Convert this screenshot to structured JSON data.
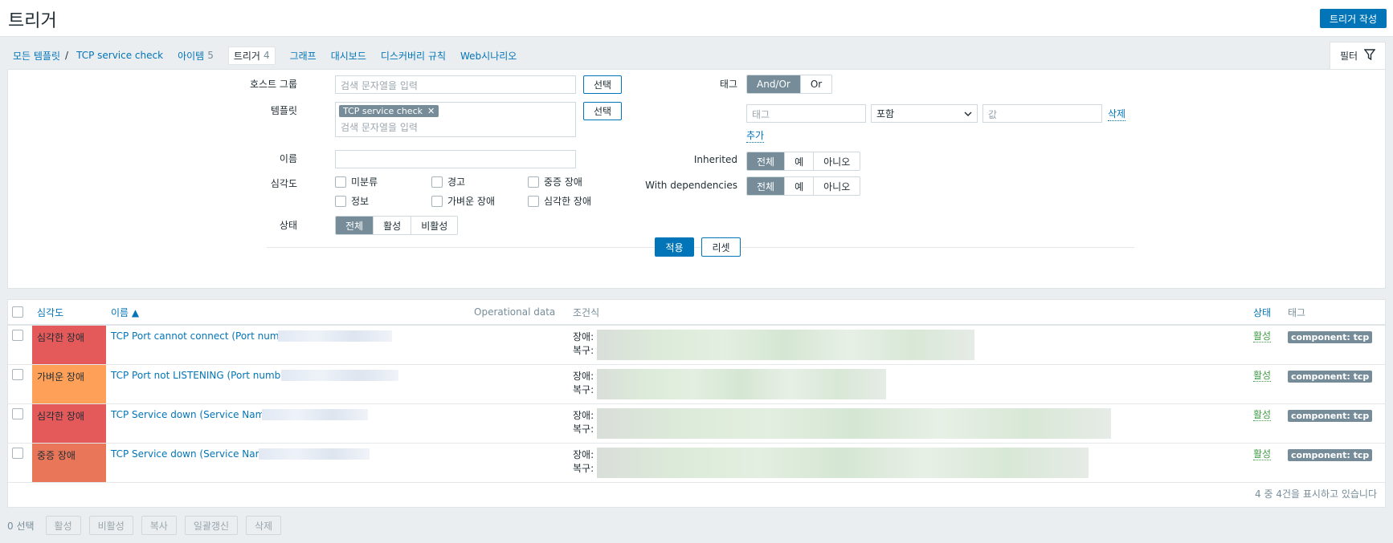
{
  "header": {
    "title": "트리거",
    "create_label": "트리거 작성"
  },
  "nav": {
    "crumbs": [
      "모든 템플릿",
      "TCP service check"
    ],
    "sep": "/",
    "tabs": [
      {
        "label": "아이템",
        "count": "5"
      },
      {
        "label": "트리거",
        "count": "4"
      },
      {
        "label": "그래프",
        "count": ""
      },
      {
        "label": "대시보드",
        "count": ""
      },
      {
        "label": "디스커버리 규칙",
        "count": ""
      },
      {
        "label": "Web시나리오",
        "count": ""
      }
    ]
  },
  "filter": {
    "tab_label": "필터",
    "host_group_label": "호스트 그룹",
    "host_group_placeholder": "검색 문자열을 입력",
    "select_label": "선택",
    "template_label": "템플릿",
    "template_chip": "TCP service check",
    "template_placeholder": "검색 문자열을 입력",
    "name_label": "이름",
    "severity_label": "심각도",
    "severities": [
      "미분류",
      "경고",
      "중증 장애",
      "정보",
      "가벼운 장애",
      "심각한 장애"
    ],
    "state_label": "상태",
    "state_options": [
      "전체",
      "활성",
      "비활성"
    ],
    "tag_label": "태그",
    "tag_logic": [
      "And/Or",
      "Or"
    ],
    "tag_placeholder": "태그",
    "tag_operator": "포함",
    "value_placeholder": "값",
    "remove_label": "삭제",
    "add_label": "추가",
    "inherited_label": "Inherited",
    "dependencies_label": "With dependencies",
    "tri_options": [
      "전체",
      "예",
      "아니오"
    ],
    "apply_label": "적용",
    "reset_label": "리셋"
  },
  "table": {
    "headers": {
      "severity": "심각도",
      "name": "이름 ▲",
      "opdata": "Operational data",
      "expression": "조건식",
      "status": "상태",
      "tags": "태그"
    },
    "rows": [
      {
        "severity": "심각한 장애",
        "color": "#e45959",
        "name": "TCP Port cannot connect (Port number",
        "problem": "장애:",
        "recovery": "복구:",
        "status": "활성",
        "tag": "component: tcp"
      },
      {
        "severity": "가벼운 장애",
        "color": "#ffa059",
        "name": "TCP Port not LISTENING (Port number",
        "problem": "장애:",
        "recovery": "복구:",
        "status": "활성",
        "tag": "component: tcp"
      },
      {
        "severity": "심각한 장애",
        "color": "#e45959",
        "name": "TCP Service down (Service Name:",
        "problem": "장애:",
        "recovery": "복구:",
        "status": "활성",
        "tag": "component: tcp"
      },
      {
        "severity": "중증 장애",
        "color": "#e97659",
        "name": "TCP Service down (Service Name",
        "problem": "장애:",
        "recovery": "복구:",
        "status": "활성",
        "tag": "component: tcp"
      }
    ],
    "footer": "4 중 4건을 표시하고 있습니다"
  },
  "actions": {
    "selected": "0 선택",
    "buttons": [
      "활성",
      "비활성",
      "복사",
      "일괄갱신",
      "삭제"
    ]
  }
}
